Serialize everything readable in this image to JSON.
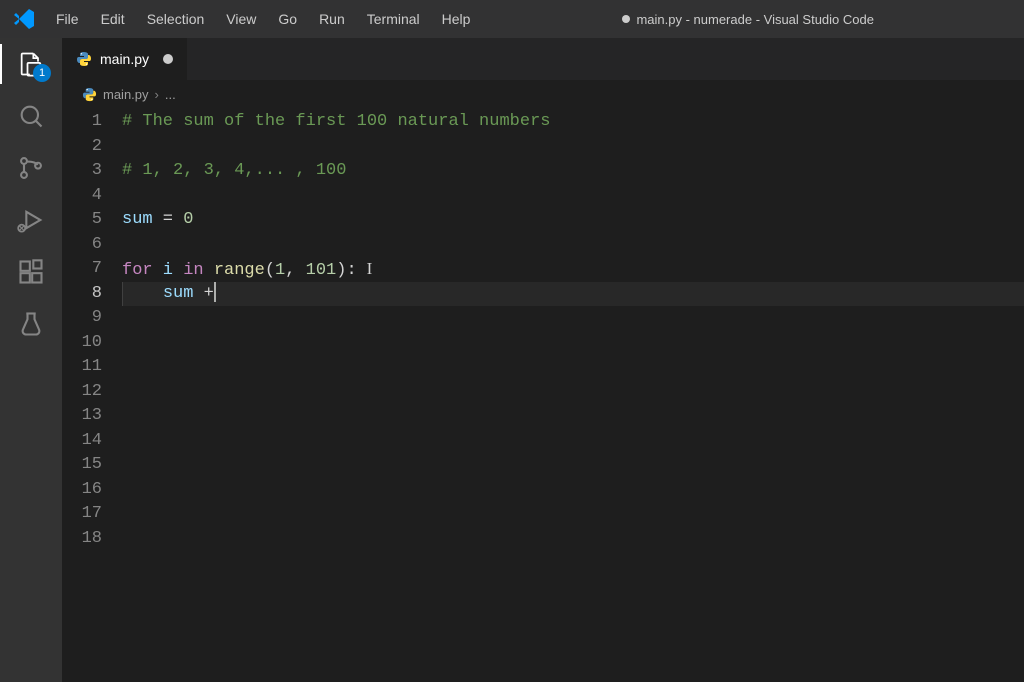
{
  "title_bar": {
    "title": "main.py - numerade - Visual Studio Code"
  },
  "menu": {
    "items": [
      "File",
      "Edit",
      "Selection",
      "View",
      "Go",
      "Run",
      "Terminal",
      "Help"
    ]
  },
  "activity_bar": {
    "explorer_badge": "1"
  },
  "tab": {
    "filename": "main.py"
  },
  "breadcrumbs": {
    "file": "main.py",
    "separator": "›",
    "more": "..."
  },
  "code": {
    "lines": [
      {
        "n": 1,
        "type": "comment",
        "text": "# The sum of the first 100 natural numbers"
      },
      {
        "n": 2,
        "type": "empty",
        "text": ""
      },
      {
        "n": 3,
        "type": "comment",
        "text": "# 1, 2, 3, 4,... , 100"
      },
      {
        "n": 4,
        "type": "empty",
        "text": ""
      },
      {
        "n": 5,
        "type": "assign",
        "var": "sum",
        "op": " = ",
        "val": "0"
      },
      {
        "n": 6,
        "type": "empty",
        "text": ""
      },
      {
        "n": 7,
        "type": "for",
        "kw1": "for",
        "var": " i ",
        "kw2": "in",
        "func": " range",
        "paren1": "(",
        "num1": "1",
        "comma": ", ",
        "num2": "101",
        "paren2": "):"
      },
      {
        "n": 8,
        "type": "sumplus",
        "indent": "    ",
        "var": "sum",
        "op": " +"
      },
      {
        "n": 9,
        "type": "empty",
        "text": ""
      },
      {
        "n": 10,
        "type": "empty",
        "text": ""
      },
      {
        "n": 11,
        "type": "empty",
        "text": ""
      },
      {
        "n": 12,
        "type": "empty",
        "text": ""
      },
      {
        "n": 13,
        "type": "empty",
        "text": ""
      },
      {
        "n": 14,
        "type": "empty",
        "text": ""
      },
      {
        "n": 15,
        "type": "empty",
        "text": ""
      },
      {
        "n": 16,
        "type": "empty",
        "text": ""
      },
      {
        "n": 17,
        "type": "empty",
        "text": ""
      },
      {
        "n": 18,
        "type": "empty",
        "text": ""
      }
    ]
  }
}
